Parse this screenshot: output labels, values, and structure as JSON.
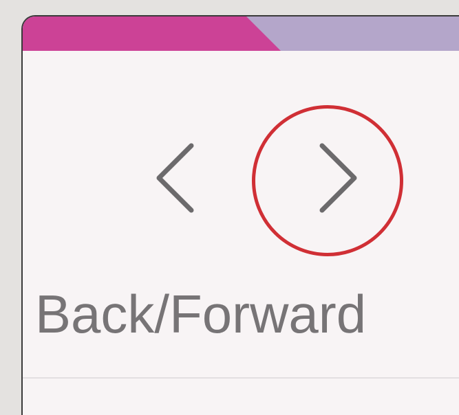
{
  "toolbar": {
    "nav_label": "Back/Forward",
    "back_icon": "chevron-left-icon",
    "forward_icon": "chevron-right-icon"
  },
  "theme": {
    "window_bg": "#f8f4f5",
    "titlebar_accent": "#cc4296",
    "titlebar_bg": "#b4a6ca",
    "icon_color": "#6c6a6c",
    "label_color": "#777476",
    "highlight_color": "#d02f35"
  }
}
